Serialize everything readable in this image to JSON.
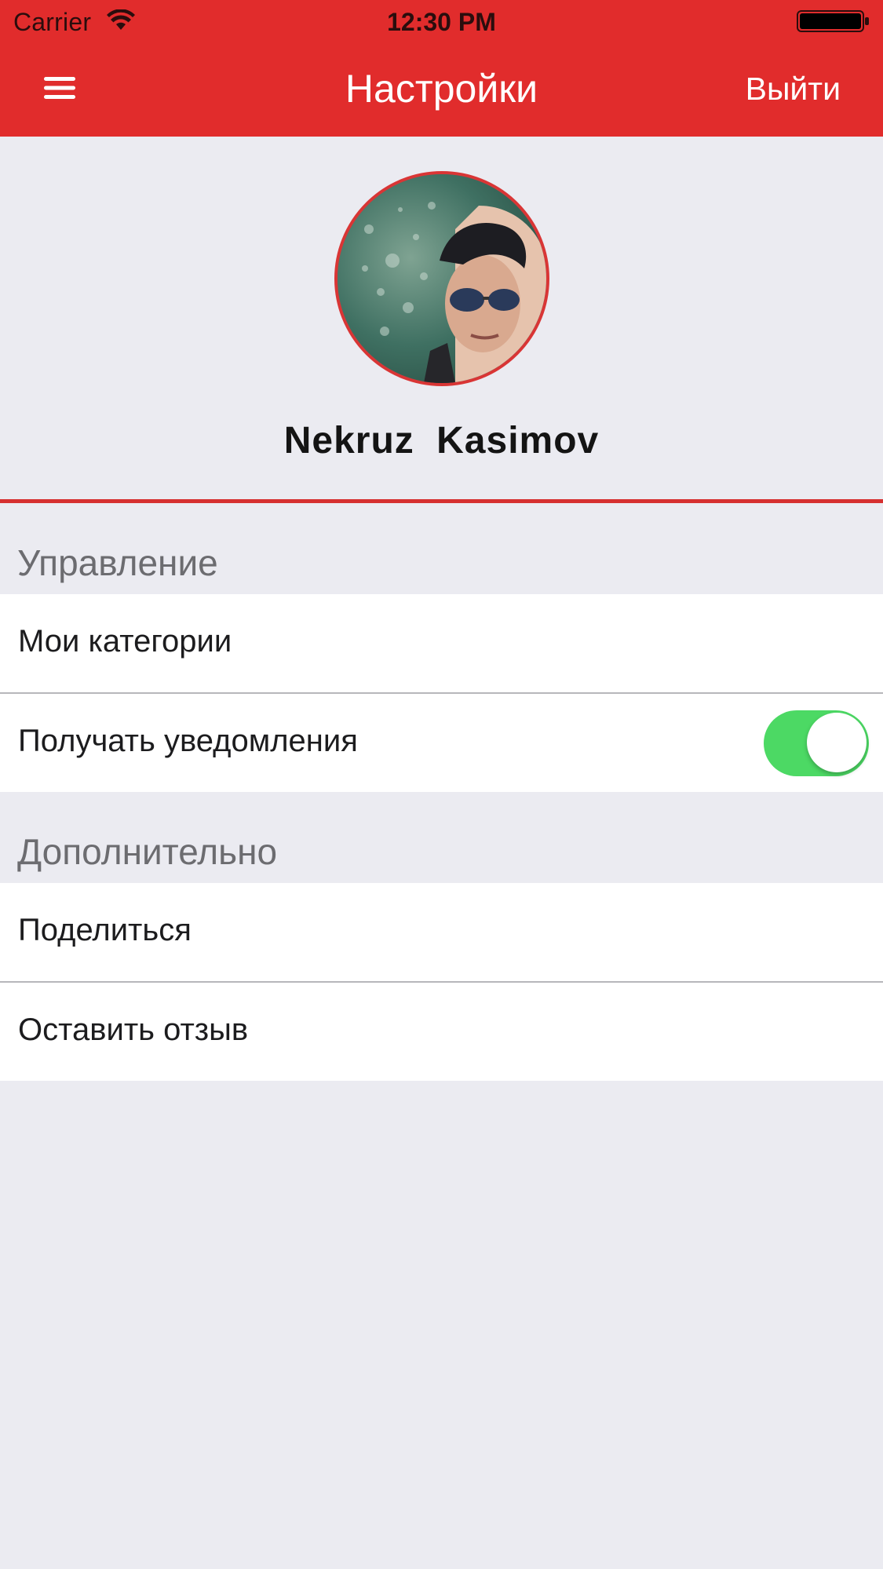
{
  "status_bar": {
    "carrier": "Carrier",
    "time": "12:30 PM",
    "wifi_icon": "wifi-icon",
    "battery_icon": "battery-full-icon"
  },
  "nav": {
    "menu_icon": "hamburger-menu-icon",
    "title": "Настройки",
    "logout_label": "Выйти"
  },
  "profile": {
    "name": "Nekruz  Kasimov"
  },
  "sections": {
    "management": {
      "title": "Управление",
      "items": [
        {
          "label": "Мои категории"
        },
        {
          "label": "Получать уведомления",
          "toggle_on": true
        }
      ]
    },
    "extra": {
      "title": "Дополнительно",
      "items": [
        {
          "label": "Поделиться"
        },
        {
          "label": "Оставить отзыв"
        }
      ]
    }
  },
  "colors": {
    "accent": "#e12c2c",
    "toggle_on": "#4cd964",
    "background": "#ebebf1"
  }
}
